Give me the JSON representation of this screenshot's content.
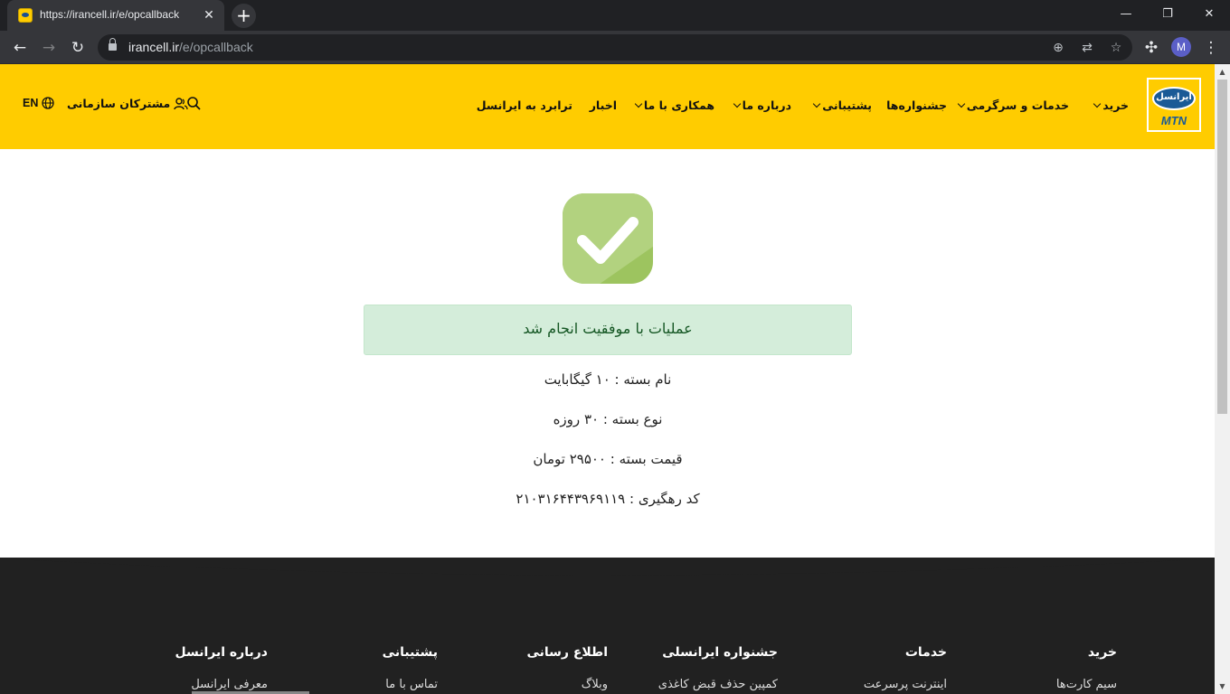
{
  "browser": {
    "tab_title": "https://irancell.ir/e/opcallback",
    "tab_close": "✕",
    "new_tab": "+",
    "url_host": "irancell.ir",
    "url_path": "/e/opcallback",
    "profile_initial": "M",
    "window_controls": {
      "minimize": "—",
      "restore": "❐",
      "close": "✕"
    }
  },
  "header": {
    "logo": {
      "brand_fa": "ایرانسل",
      "brand_mtn": "MTN"
    },
    "nav": [
      {
        "label": "خرید",
        "dropdown": true
      },
      {
        "label": "خدمات و سرگرمی",
        "dropdown": true
      },
      {
        "label": "جشنواره‌ها",
        "dropdown": false
      },
      {
        "label": "پشتیبانی",
        "dropdown": true
      },
      {
        "label": "درباره ما",
        "dropdown": true
      },
      {
        "label": "همکاری با ما",
        "dropdown": true
      },
      {
        "label": "اخبار",
        "dropdown": false
      },
      {
        "label": "ترابرد به ایرانسل",
        "dropdown": false
      }
    ],
    "corporate_label": "مشترکان سازمانی",
    "language_label": "EN"
  },
  "result": {
    "message": "عملیات با موفقیت انجام شد",
    "package_name": "نام بسته : ۱۰ گیگابایت",
    "package_type": "نوع بسته : ۳۰ روزه",
    "package_price": "قیمت بسته : ۲۹۵۰۰ تومان",
    "tracking_code": "کد رهگیری : ۲۱۰۳۱۶۴۴۳۹۶۹۱۱۹"
  },
  "footer": {
    "columns": [
      {
        "title": "خرید",
        "first_link": "سیم کارت‌ها"
      },
      {
        "title": "خدمات",
        "first_link": "اینترنت پرسرعت"
      },
      {
        "title": "جشنواره ایرانسلی",
        "first_link": "کمپین حذف قبض کاغذی"
      },
      {
        "title": "اطلاع رسانی",
        "first_link": "وبلاگ"
      },
      {
        "title": "پشتیبانی",
        "first_link": "تماس با ما"
      },
      {
        "title": "درباره ایرانسل",
        "first_link": "معرفی ایرانسل"
      }
    ]
  },
  "colors": {
    "brand_yellow": "#ffcc00",
    "success_green": "#9dc45f",
    "alert_bg": "#d4edda",
    "footer_bg": "#212121"
  }
}
